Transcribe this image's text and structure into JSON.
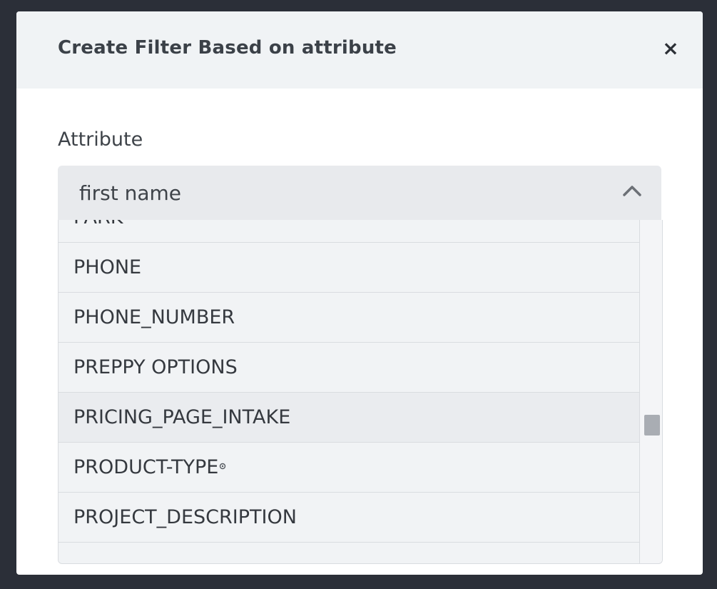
{
  "modal": {
    "title": "Create Filter Based on attribute",
    "close_label": "×"
  },
  "attribute_field": {
    "label": "Attribute",
    "selected_value": "first name",
    "options": [
      "PARK",
      "PHONE",
      "PHONE_NUMBER",
      "PREPPY OPTIONS",
      "PRICING_PAGE_INTAKE",
      "PRODUCT-TYPE",
      "PROJECT_DESCRIPTION",
      ""
    ],
    "hovered_option": "PRICING_PAGE_INTAKE"
  },
  "icons": {
    "close": "close-icon",
    "chevron": "chevron-up-icon",
    "cursor": "busy-cursor-icon"
  },
  "colors": {
    "backdrop": "#2b2f38",
    "header_bg": "#f0f3f5",
    "select_bg": "#e8eaed",
    "list_bg": "#f1f3f5",
    "scroll_thumb": "#a9adb3"
  }
}
